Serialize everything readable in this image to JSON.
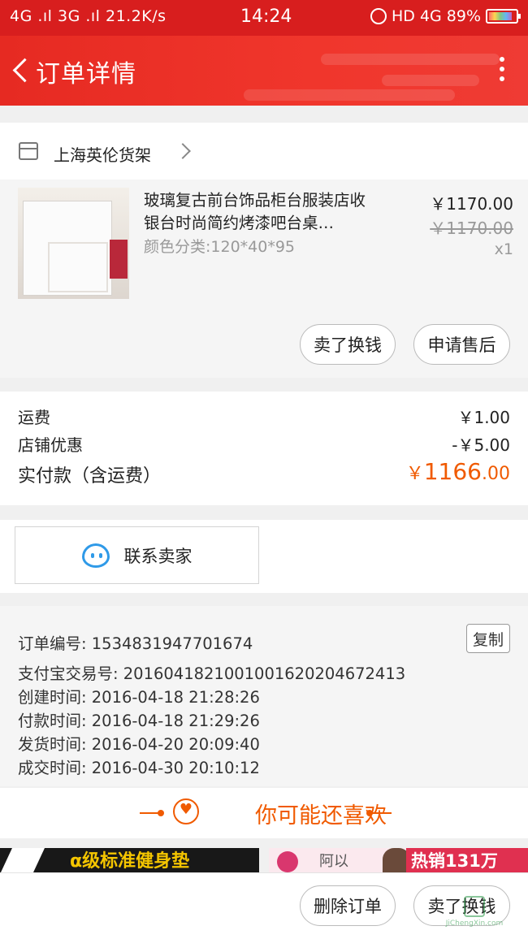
{
  "status_bar": {
    "left_text": "4G .ıl 3G .ıl 21.2K/s",
    "time": "14:24",
    "network": "HD 4G",
    "battery": "89%"
  },
  "header": {
    "title": "订单详情"
  },
  "shop": {
    "name": "上海英伦货架"
  },
  "product": {
    "name": "玻璃复古前台饰品柜台服装店收银台时尚简约烤漆吧台桌…",
    "spec": "颜色分类:120*40*95",
    "price": "￥1170.00",
    "original_price": "￥1170.00",
    "quantity": "x1"
  },
  "actions": {
    "sell_label": "卖了换钱",
    "after_sale_label": "申请售后"
  },
  "fees": {
    "shipping_label": "运费",
    "shipping_value": "￥1.00",
    "discount_label": "店铺优惠",
    "discount_value": "-￥5.00",
    "total_label": "实付款（含运费）",
    "total_currency": "￥",
    "total_int": "1166",
    "total_dec": ".00"
  },
  "contact": {
    "label": "联系卖家"
  },
  "order_info": {
    "copy_label": "复制",
    "rows": [
      "订单编号: 1534831947701674",
      "支付宝交易号: 2016041821001001620204672413",
      "创建时间: 2016-04-18 21:28:26",
      "付款时间: 2016-04-18 21:29:26",
      "发货时间: 2016-04-20 20:09:40",
      "成交时间: 2016-04-30 20:10:12"
    ]
  },
  "recommend": {
    "title": "你可能还喜欢",
    "banner1_text": "α级标准健身垫",
    "banner2_hot": "热销131万",
    "banner2_text": "阿以"
  },
  "bottom": {
    "delete_label": "删除订单",
    "sell_label": "卖了换钱"
  },
  "watermark": {
    "text": "JiChengXin.com"
  },
  "colors": {
    "brand_red": "#e62a22",
    "accent_orange": "#f05a00",
    "chat_blue": "#2f9ae8"
  }
}
